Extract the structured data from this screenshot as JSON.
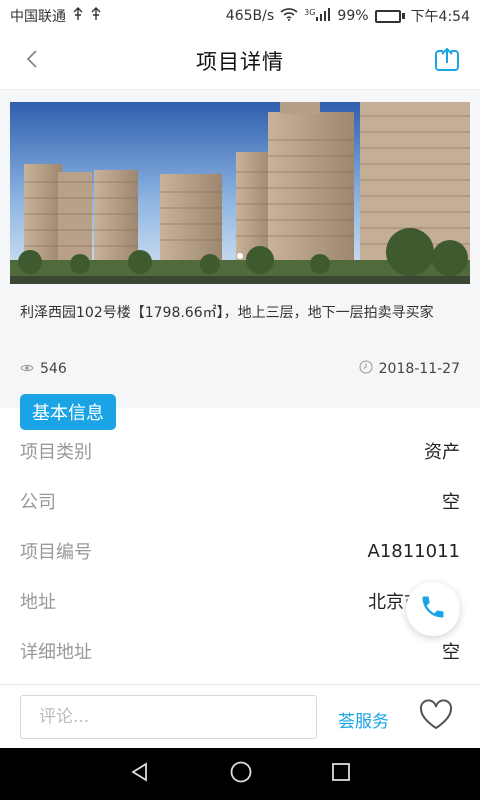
{
  "status_bar": {
    "carrier": "中国联通",
    "speed": "465B/s",
    "network": "3G",
    "battery": "99%",
    "battery_level": 0.99,
    "time": "下午4:54"
  },
  "nav": {
    "title": "项目详情",
    "back_icon": "chevron-left-icon",
    "share_icon": "share-icon"
  },
  "project": {
    "description": "利泽西园102号楼【1798.66㎡】，地上三层，地下一层拍卖寻买家",
    "views": "546",
    "date": "2018-11-27"
  },
  "section": {
    "title": "基本信息"
  },
  "info": [
    {
      "label": "项目类别",
      "value": "资产"
    },
    {
      "label": "公司",
      "value": "空"
    },
    {
      "label": "项目编号",
      "value": "A1811011"
    },
    {
      "label": "地址",
      "value": "北京市市"
    },
    {
      "label": "详细地址",
      "value": "空"
    }
  ],
  "comment_bar": {
    "placeholder": "评论...",
    "service_label": "荟服务"
  },
  "colors": {
    "accent": "#1aa4e6",
    "panel_bg": "#f5f6f8",
    "label_gray": "#999999"
  }
}
